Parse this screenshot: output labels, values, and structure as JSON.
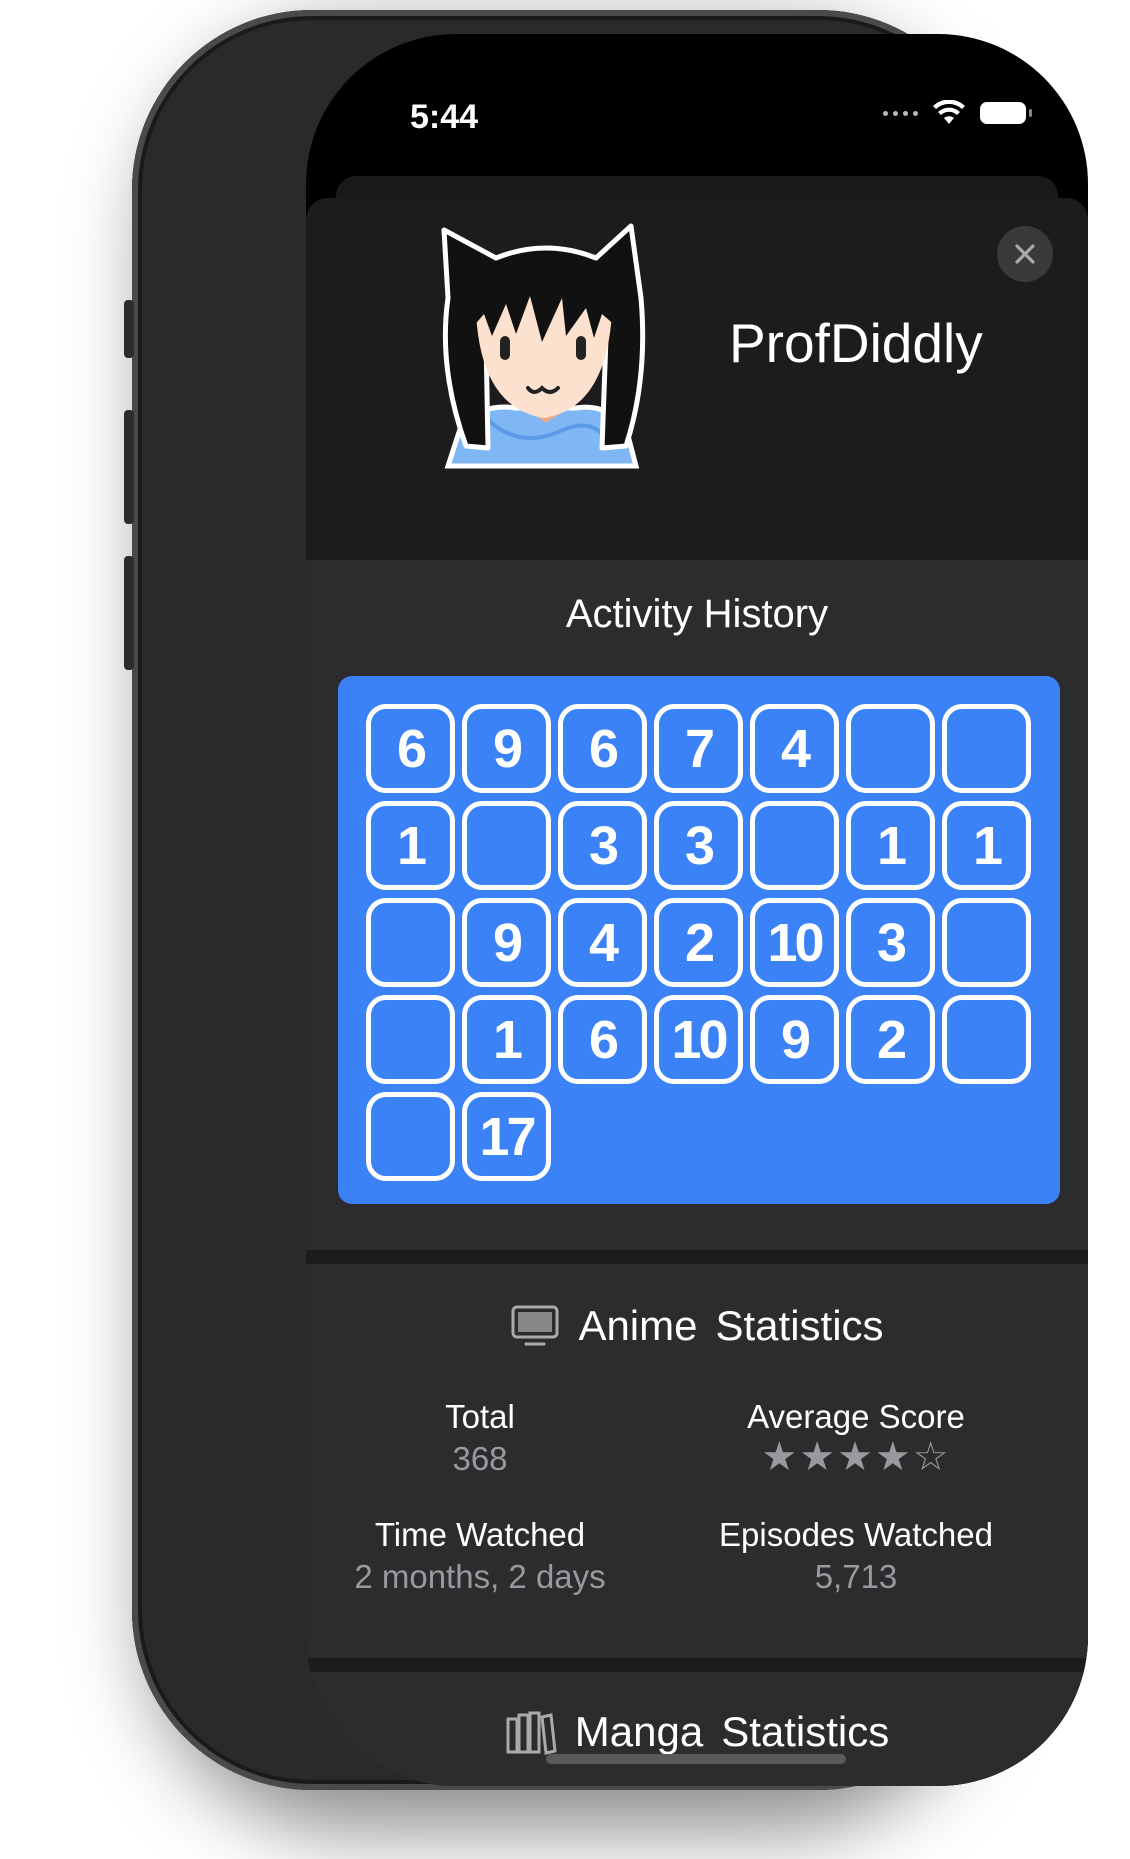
{
  "status_bar": {
    "time": "5:44"
  },
  "profile": {
    "username": "ProfDiddly",
    "avatar_icon": "cat-ear-girl-avatar",
    "close_icon": "close-icon"
  },
  "activity": {
    "title": "Activity History",
    "panel_color": "#3a82f6",
    "cells": [
      "6",
      "9",
      "6",
      "7",
      "4",
      "",
      "",
      "1",
      "",
      "3",
      "3",
      "",
      "1",
      "1",
      "",
      "9",
      "4",
      "2",
      "10",
      "3",
      "",
      "",
      "1",
      "6",
      "10",
      "9",
      "2",
      "",
      "",
      "17"
    ]
  },
  "anime_stats": {
    "title_word1": "Anime",
    "title_word2": "Statistics",
    "icon": "tv-icon",
    "total_label": "Total",
    "total_value": "368",
    "avg_label": "Average Score",
    "avg_stars": "★★★★☆",
    "avg_rating": 4,
    "time_label": "Time Watched",
    "time_value": "2 months, 2 days",
    "episodes_label": "Episodes Watched",
    "episodes_value": "5,713"
  },
  "manga_stats": {
    "title_word1": "Manga",
    "title_word2": "Statistics",
    "icon": "books-icon"
  }
}
